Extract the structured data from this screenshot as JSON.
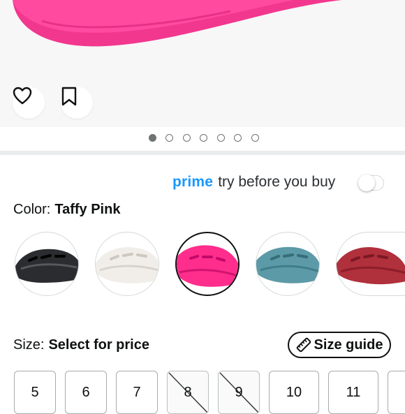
{
  "product_image": {
    "dots": {
      "count": 7,
      "active_index": 0
    }
  },
  "actions": {
    "wishlist_icon": "heart-outline",
    "save_icon": "bookmark-outline"
  },
  "prime": {
    "brand": "prime",
    "text": "try before you buy",
    "toggle_on": false
  },
  "color": {
    "label": "Color:",
    "selected": "Taffy Pink",
    "swatches": [
      {
        "name": "black",
        "color": "#2a2c30"
      },
      {
        "name": "white",
        "color": "#f1eeea"
      },
      {
        "name": "taffy-pink",
        "color": "#ff2d8c",
        "selected": true
      },
      {
        "name": "teal",
        "color": "#5b9aa6"
      },
      {
        "name": "red",
        "color": "#b0303c"
      }
    ]
  },
  "size": {
    "label": "Size:",
    "value": "Select for price",
    "guide_label": "Size guide",
    "options": [
      {
        "label": "5",
        "available": true
      },
      {
        "label": "6",
        "available": true
      },
      {
        "label": "7",
        "available": true
      },
      {
        "label": "8",
        "available": false
      },
      {
        "label": "9",
        "available": false
      },
      {
        "label": "10",
        "available": true
      },
      {
        "label": "11",
        "available": true
      }
    ]
  }
}
